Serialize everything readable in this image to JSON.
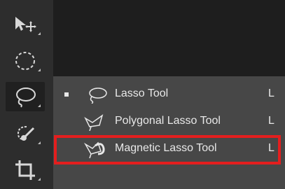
{
  "toolbar": {
    "tools": [
      {
        "name": "move-tool",
        "icon": "move-icon"
      },
      {
        "name": "marquee-tool",
        "icon": "elliptical-marquee-icon"
      },
      {
        "name": "lasso-tool",
        "icon": "lasso-icon",
        "active": true
      },
      {
        "name": "quick-selection-tool",
        "icon": "quick-selection-icon"
      },
      {
        "name": "crop-tool",
        "icon": "crop-icon"
      }
    ]
  },
  "flyout_menu": {
    "items": [
      {
        "label": "Lasso Tool",
        "shortcut": "L",
        "icon": "lasso-icon",
        "checked": true
      },
      {
        "label": "Polygonal Lasso Tool",
        "shortcut": "L",
        "icon": "polygonal-lasso-icon",
        "checked": false
      },
      {
        "label": "Magnetic Lasso Tool",
        "shortcut": "L",
        "icon": "magnetic-lasso-icon",
        "checked": false,
        "highlighted": true
      }
    ]
  },
  "colors": {
    "highlight": "#e41e1e",
    "menu_background": "#474747",
    "toolbar_background": "#2d2d2d",
    "text": "#e8e8e8"
  }
}
